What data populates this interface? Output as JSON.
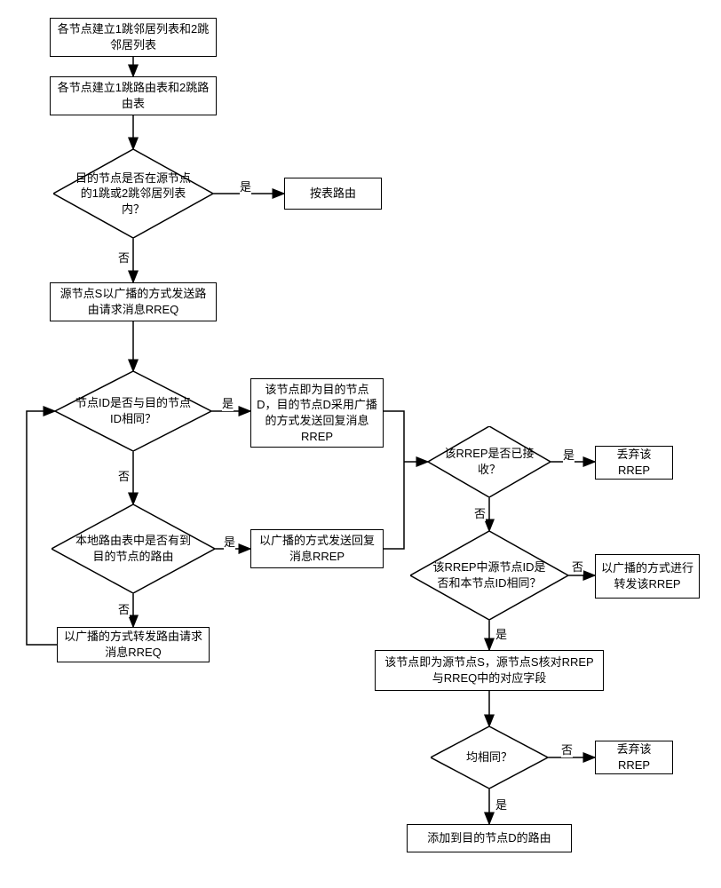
{
  "nodes": {
    "n1": "各节点建立1跳邻居列表和2跳邻居列表",
    "n2": "各节点建立1跳路由表和2跳路由表",
    "d1": "目的节点是否在源节点的1跳或2跳邻居列表内？",
    "n3": "按表路由",
    "n4": "源节点S以广播的方式发送路由请求消息RREQ",
    "d2": "节点ID是否与目的节点ID相同？",
    "n5": "该节点即为目的节点D，目的节点D采用广播的方式发送回复消息RREP",
    "d3": "本地路由表中是否有到目的节点的路由",
    "n6": "以广播的方式发送回复消息RREP",
    "n7": "以广播的方式转发路由请求消息RREQ",
    "d4": "该RREP是否已接收？",
    "n8": "丢弃该RREP",
    "d5": "该RREP中源节点ID是否和本节点ID相同？",
    "n9": "以广播的方式进行转发该RREP",
    "n10": "该节点即为源节点S，源节点S核对RREP与RREQ中的对应字段",
    "d6": "均相同？",
    "n11": "丢弃该RREP",
    "n12": "添加到目的节点D的路由"
  },
  "labels": {
    "yes": "是",
    "no": "否"
  },
  "chart_data": {
    "type": "flowchart",
    "title": "",
    "nodes": [
      {
        "id": "n1",
        "type": "process",
        "text": "各节点建立1跳邻居列表和2跳邻居列表"
      },
      {
        "id": "n2",
        "type": "process",
        "text": "各节点建立1跳路由表和2跳路由表"
      },
      {
        "id": "d1",
        "type": "decision",
        "text": "目的节点是否在源节点的1跳或2跳邻居列表内？"
      },
      {
        "id": "n3",
        "type": "process",
        "text": "按表路由"
      },
      {
        "id": "n4",
        "type": "process",
        "text": "源节点S以广播的方式发送路由请求消息RREQ"
      },
      {
        "id": "d2",
        "type": "decision",
        "text": "节点ID是否与目的节点ID相同？"
      },
      {
        "id": "n5",
        "type": "process",
        "text": "该节点即为目的节点D，目的节点D采用广播的方式发送回复消息RREP"
      },
      {
        "id": "d3",
        "type": "decision",
        "text": "本地路由表中是否有到目的节点的路由"
      },
      {
        "id": "n6",
        "type": "process",
        "text": "以广播的方式发送回复消息RREP"
      },
      {
        "id": "n7",
        "type": "process",
        "text": "以广播的方式转发路由请求消息RREQ"
      },
      {
        "id": "d4",
        "type": "decision",
        "text": "该RREP是否已接收？"
      },
      {
        "id": "n8",
        "type": "process",
        "text": "丢弃该RREP"
      },
      {
        "id": "d5",
        "type": "decision",
        "text": "该RREP中源节点ID是否和本节点ID相同？"
      },
      {
        "id": "n9",
        "type": "process",
        "text": "以广播的方式进行转发该RREP"
      },
      {
        "id": "n10",
        "type": "process",
        "text": "该节点即为源节点S，源节点S核对RREP与RREQ中的对应字段"
      },
      {
        "id": "d6",
        "type": "decision",
        "text": "均相同？"
      },
      {
        "id": "n11",
        "type": "process",
        "text": "丢弃该RREP"
      },
      {
        "id": "n12",
        "type": "process",
        "text": "添加到目的节点D的路由"
      }
    ],
    "edges": [
      {
        "from": "n1",
        "to": "n2"
      },
      {
        "from": "n2",
        "to": "d1"
      },
      {
        "from": "d1",
        "to": "n3",
        "label": "是"
      },
      {
        "from": "d1",
        "to": "n4",
        "label": "否"
      },
      {
        "from": "n4",
        "to": "d2"
      },
      {
        "from": "d2",
        "to": "n5",
        "label": "是"
      },
      {
        "from": "d2",
        "to": "d3",
        "label": "否"
      },
      {
        "from": "d3",
        "to": "n6",
        "label": "是"
      },
      {
        "from": "d3",
        "to": "n7",
        "label": "否"
      },
      {
        "from": "n7",
        "to": "d2",
        "note": "loop back"
      },
      {
        "from": "n5",
        "to": "d4"
      },
      {
        "from": "n6",
        "to": "d4"
      },
      {
        "from": "d4",
        "to": "n8",
        "label": "是"
      },
      {
        "from": "d4",
        "to": "d5",
        "label": "否"
      },
      {
        "from": "d5",
        "to": "n9",
        "label": "否"
      },
      {
        "from": "d5",
        "to": "n10",
        "label": "是"
      },
      {
        "from": "n10",
        "to": "d6"
      },
      {
        "from": "d6",
        "to": "n11",
        "label": "否"
      },
      {
        "from": "d6",
        "to": "n12",
        "label": "是"
      }
    ]
  }
}
